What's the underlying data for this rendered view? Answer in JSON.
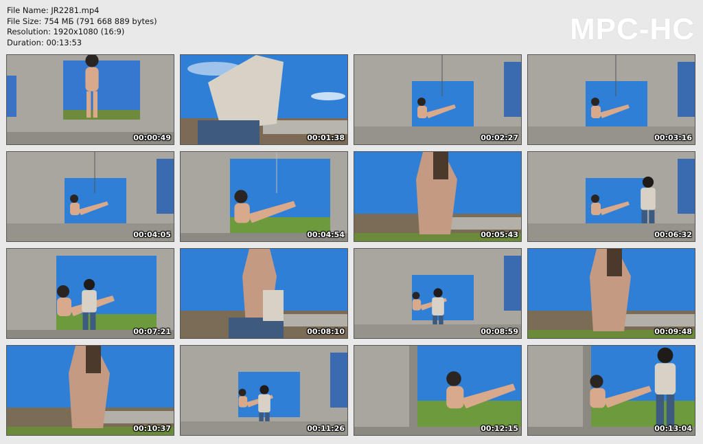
{
  "file_info": {
    "name": "File Name: JR2281.mp4",
    "size": "File Size: 754 МБ (791 668 889 bytes)",
    "resolution": "Resolution: 1920x1080 (16:9)",
    "duration": "Duration: 00:13:53"
  },
  "logo": "MPC-HC",
  "thumbnails": [
    {
      "time": "00:00:49",
      "scene": "wall-window-standing"
    },
    {
      "time": "00:01:38",
      "scene": "low-angle-man"
    },
    {
      "time": "00:02:27",
      "scene": "wall-window-suspended"
    },
    {
      "time": "00:03:16",
      "scene": "wall-window-suspended"
    },
    {
      "time": "00:04:05",
      "scene": "wall-window-suspended"
    },
    {
      "time": "00:04:54",
      "scene": "window-closeup"
    },
    {
      "time": "00:05:43",
      "scene": "sky-feet"
    },
    {
      "time": "00:06:32",
      "scene": "wall-window-man"
    },
    {
      "time": "00:07:21",
      "scene": "window-closeup-man"
    },
    {
      "time": "00:08:10",
      "scene": "sky-feet-man"
    },
    {
      "time": "00:08:59",
      "scene": "wall-window-man-center"
    },
    {
      "time": "00:09:48",
      "scene": "sky-feet"
    },
    {
      "time": "00:10:37",
      "scene": "sky-feet"
    },
    {
      "time": "00:11:26",
      "scene": "wall-window-man-center"
    },
    {
      "time": "00:12:15",
      "scene": "window-seated"
    },
    {
      "time": "00:13:04",
      "scene": "window-seated-man"
    }
  ],
  "colors": {
    "background": "#e9e9e9",
    "sky": "#2f7fd6",
    "concrete": "#a9a69f",
    "timestamp": "#ffffff"
  }
}
